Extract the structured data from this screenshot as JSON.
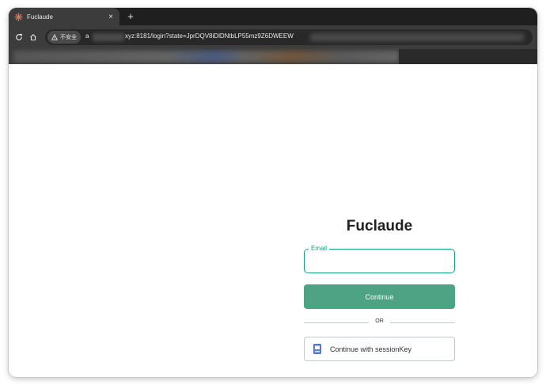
{
  "browser": {
    "tab_title": "Fuclaude",
    "tab_close": "×",
    "new_tab": "+",
    "security_label": "不安全",
    "url_prefix": "a",
    "url_text": "xyz:8181/login?state=JprDQV8iDlDNtbLP55mz9Z6DWEEW"
  },
  "login": {
    "title": "Fuclaude",
    "email_label": "Email",
    "email_value": "",
    "continue_label": "Continue",
    "or_label": "OR",
    "session_label": "Continue with sessionKey"
  },
  "colors": {
    "accent": "#10a37f",
    "button": "#4da383",
    "chrome_dark": "#3c3c3c"
  }
}
